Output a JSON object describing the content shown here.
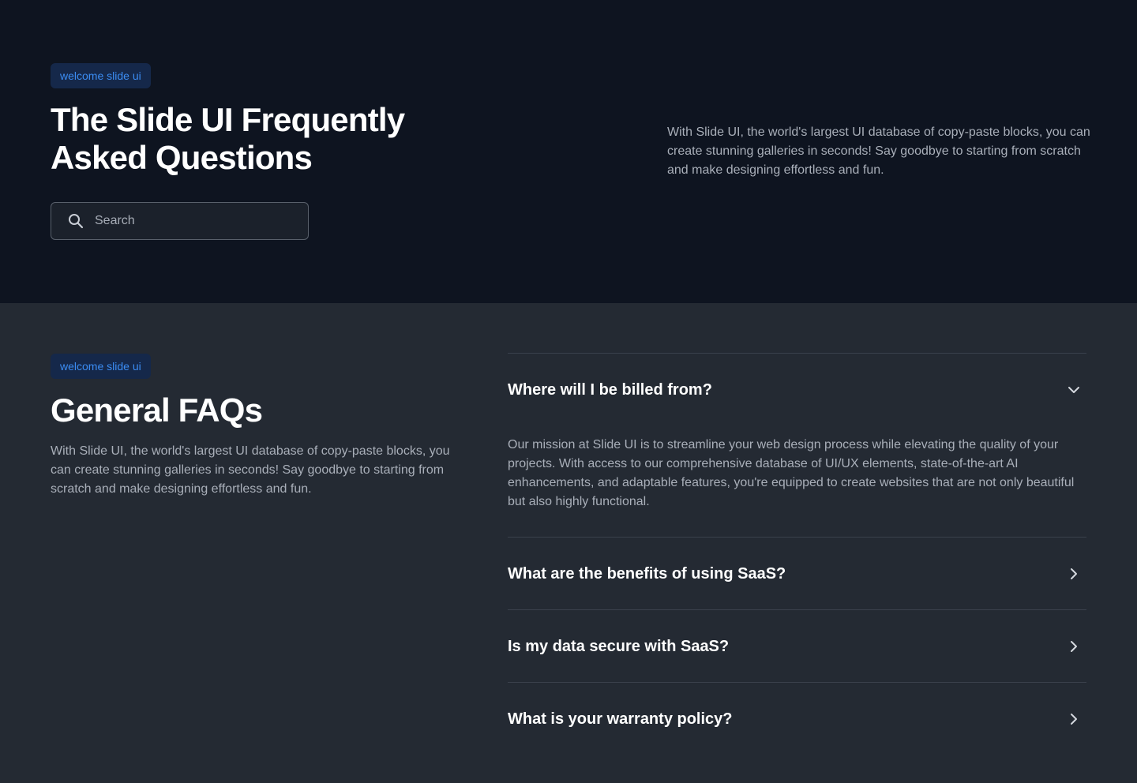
{
  "hero": {
    "badge": "welcome slide ui",
    "title": "The Slide UI Frequently Asked Questions",
    "search_placeholder": "Search",
    "description": "With Slide UI, the world's largest UI database of copy-paste blocks, you can create stunning galleries in seconds! Say goodbye to starting from scratch and make designing effortless and fun."
  },
  "faq": {
    "badge": "welcome slide ui",
    "title": "General FAQs",
    "description": "With Slide UI, the world's largest UI database of copy-paste blocks, you can create stunning galleries in seconds! Say goodbye to starting from scratch and make designing effortless and fun.",
    "items": [
      {
        "question": "Where will I be billed from?",
        "expanded": true,
        "icon": "chevron-down-icon",
        "answer": "Our mission at Slide UI is to streamline your web design process while elevating the quality of your projects. With access to our comprehensive database of UI/UX elements, state-of-the-art AI enhancements, and adaptable features, you're equipped to create websites that are not only beautiful but also highly functional."
      },
      {
        "question": "What are the benefits of using SaaS?",
        "expanded": false,
        "icon": "chevron-right-icon"
      },
      {
        "question": "Is my data secure with SaaS?",
        "expanded": false,
        "icon": "chevron-right-icon"
      },
      {
        "question": "What is your warranty policy?",
        "expanded": false,
        "icon": "chevron-right-icon"
      }
    ]
  },
  "colors": {
    "hero_background": "#0e1420",
    "section_background": "#242a33",
    "badge_background": "#15284a",
    "badge_text": "#3b8cf2",
    "heading": "#ffffff",
    "body_text": "#a9afb9",
    "divider": "#3a414c"
  }
}
